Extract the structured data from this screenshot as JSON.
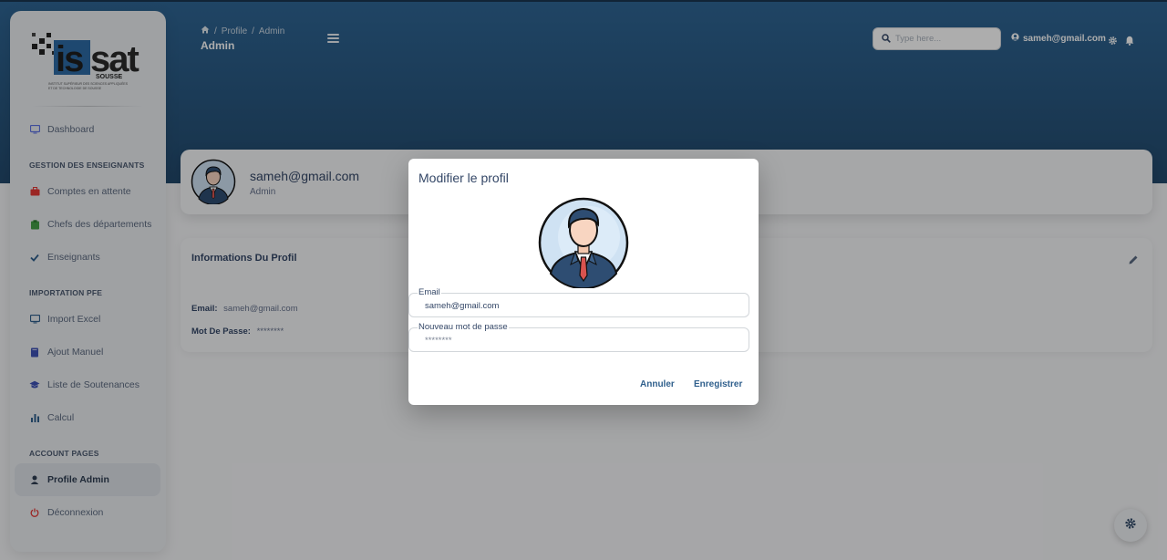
{
  "colors": {
    "primary": "#2f6695",
    "accent_red": "#e53935",
    "accent_green": "#43a047",
    "accent_blue": "#2f5f8c"
  },
  "logo": {
    "brand": "issat",
    "city": "SOUSSE",
    "line1": "INSTITUT SUPÉRIEUR DES SCIENCES APPLIQUÉES",
    "line2": "ET DE TECHNOLOGIE DE SOUSSE"
  },
  "sidebar": {
    "dashboard": "Dashboard",
    "section1": "GESTION DES ENSEIGNANTS",
    "comptes": "Comptes en attente",
    "chefs": "Chefs des départements",
    "enseignants": "Enseignants",
    "section2": "IMPORTATION PFE",
    "import": "Import Excel",
    "ajout": "Ajout Manuel",
    "soutenances": "Liste de Soutenances",
    "calcul": "Calcul",
    "section3": "ACCOUNT PAGES",
    "profile": "Profile Admin",
    "logout": "Déconnexion"
  },
  "navbar": {
    "crumb1": "Profile",
    "crumb2": "Admin",
    "title": "Admin",
    "search_placeholder": "Type here...",
    "user": "sameh@gmail.com"
  },
  "profile": {
    "name": "sameh@gmail.com",
    "role": "Admin"
  },
  "info": {
    "title": "Informations Du Profil",
    "email_label": "Email:",
    "email_value": "sameh@gmail.com",
    "password_label": "Mot De Passe:",
    "password_value": "********"
  },
  "modal": {
    "title": "Modifier le profil",
    "email_label": "Email",
    "email_value": "sameh@gmail.com",
    "password_label": "Nouveau mot de passe",
    "password_placeholder": "********",
    "cancel": "Annuler",
    "save": "Enregistrer"
  }
}
